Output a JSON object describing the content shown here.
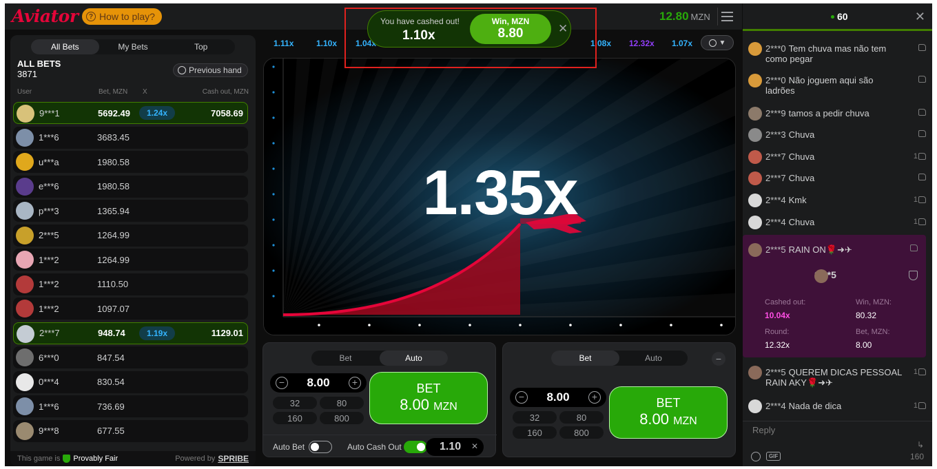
{
  "header": {
    "logo": "Aviator",
    "how_to_play": "How to play?",
    "balance": "12.80",
    "currency": "MZN"
  },
  "bets_panel": {
    "tabs": [
      "All Bets",
      "My Bets",
      "Top"
    ],
    "title": "ALL BETS",
    "count": "3871",
    "previous_hand": "Previous hand",
    "columns": {
      "user": "User",
      "bet": "Bet, MZN",
      "x": "X",
      "cashout": "Cash out, MZN"
    },
    "rows": [
      {
        "user": "9***1",
        "bet": "5692.49",
        "mult": "1.24x",
        "cashout": "7058.69",
        "win": true,
        "avatar_color": "#d8c27a"
      },
      {
        "user": "1***6",
        "bet": "3683.45",
        "mult": "",
        "cashout": "",
        "win": false,
        "avatar_color": "#7d8fa8"
      },
      {
        "user": "u***a",
        "bet": "1980.58",
        "mult": "",
        "cashout": "",
        "win": false,
        "avatar_color": "#e0a81c"
      },
      {
        "user": "e***6",
        "bet": "1980.58",
        "mult": "",
        "cashout": "",
        "win": false,
        "avatar_color": "#5a3c8c"
      },
      {
        "user": "p***3",
        "bet": "1365.94",
        "mult": "",
        "cashout": "",
        "win": false,
        "avatar_color": "#a9b6c4"
      },
      {
        "user": "2***5",
        "bet": "1264.99",
        "mult": "",
        "cashout": "",
        "win": false,
        "avatar_color": "#c8a02a"
      },
      {
        "user": "1***2",
        "bet": "1264.99",
        "mult": "",
        "cashout": "",
        "win": false,
        "avatar_color": "#e8a6b4"
      },
      {
        "user": "1***2",
        "bet": "1110.50",
        "mult": "",
        "cashout": "",
        "win": false,
        "avatar_color": "#b33a3a"
      },
      {
        "user": "1***2",
        "bet": "1097.07",
        "mult": "",
        "cashout": "",
        "win": false,
        "avatar_color": "#b33a3a"
      },
      {
        "user": "2***7",
        "bet": "948.74",
        "mult": "1.19x",
        "cashout": "1129.01",
        "win": true,
        "avatar_color": "#c4ccd4"
      },
      {
        "user": "6***0",
        "bet": "847.54",
        "mult": "",
        "cashout": "",
        "win": false,
        "avatar_color": "#6e6e6e"
      },
      {
        "user": "0***4",
        "bet": "830.54",
        "mult": "",
        "cashout": "",
        "win": false,
        "avatar_color": "#e8e8e8"
      },
      {
        "user": "1***6",
        "bet": "736.69",
        "mult": "",
        "cashout": "",
        "win": false,
        "avatar_color": "#7d8fa8"
      },
      {
        "user": "9***8",
        "bet": "677.55",
        "mult": "",
        "cashout": "",
        "win": false,
        "avatar_color": "#9a8a70"
      }
    ],
    "footer": {
      "prefix": "This game is",
      "provably_fair": "Provably Fair",
      "powered_by": "Powered by",
      "brand": "SPRIBE"
    }
  },
  "history": [
    {
      "v": "1.11x",
      "purple": false
    },
    {
      "v": "1.10x",
      "purple": false
    },
    {
      "v": "1.04x",
      "purple": false
    },
    {
      "v": "1.08x",
      "purple": false
    },
    {
      "v": "12.32x",
      "purple": true
    },
    {
      "v": "1.07x",
      "purple": false
    }
  ],
  "game": {
    "multiplier": "1.35x"
  },
  "notification": {
    "message": "You have cashed out!",
    "multiplier": "1.10x",
    "win_label": "Win, MZN",
    "win_value": "8.80"
  },
  "bet_panels": [
    {
      "tabs": [
        "Bet",
        "Auto"
      ],
      "active_tab": 1,
      "stake": "8.00",
      "chips": [
        "32",
        "80",
        "160",
        "800"
      ],
      "button_label": "BET",
      "button_amount": "8.00",
      "button_currency": "MZN",
      "auto_bet_label": "Auto Bet",
      "auto_cashout_label": "Auto Cash Out",
      "auto_cashout_value": "1.10"
    },
    {
      "tabs": [
        "Bet",
        "Auto"
      ],
      "active_tab": 0,
      "stake": "8.00",
      "chips": [
        "32",
        "80",
        "160",
        "800"
      ],
      "button_label": "BET",
      "button_amount": "8.00",
      "button_currency": "MZN"
    }
  ],
  "chat": {
    "online": "60",
    "messages": [
      {
        "user": "2***0",
        "text": "Tem chuva mas não tem como pegar",
        "likes": "",
        "avatar_color": "#d89a3a"
      },
      {
        "user": "2***0",
        "text": "Não joguem aqui são ladrões",
        "likes": "",
        "avatar_color": "#d89a3a"
      },
      {
        "user": "2***9",
        "text": "tamos a pedir chuva",
        "likes": "",
        "avatar_color": "#8c7a6a"
      },
      {
        "user": "2***3",
        "text": "Chuva",
        "likes": "",
        "avatar_color": "#8a8a8a"
      },
      {
        "user": "2***7",
        "text": "Chuva",
        "likes": "1",
        "avatar_color": "#c05a4a"
      },
      {
        "user": "2***7",
        "text": "Chuva",
        "likes": "",
        "avatar_color": "#c05a4a"
      },
      {
        "user": "2***4",
        "text": "Kmk",
        "likes": "1",
        "avatar_color": "#d8d8d8"
      },
      {
        "user": "2***4",
        "text": "Chuva",
        "likes": "1",
        "avatar_color": "#d8d8d8"
      }
    ],
    "rain": {
      "user": "2***5",
      "text": "RAIN ON🌹➜✈",
      "card_user": "2***5",
      "cashed_out_label": "Cashed out:",
      "cashed_out": "10.04x",
      "win_label": "Win, MZN:",
      "win": "80.32",
      "round_label": "Round:",
      "round": "12.32x",
      "bet_label": "Bet, MZN:",
      "bet": "8.00"
    },
    "after": [
      {
        "user": "2***5",
        "text": "QUEREM DICAS PESSOAL RAIN AKY🌹➜✈",
        "likes": "1",
        "avatar_color": "#8a6a5a"
      },
      {
        "user": "2***4",
        "text": "Nada de dica",
        "likes": "1",
        "avatar_color": "#d8d8d8"
      }
    ],
    "reply_placeholder": "Reply",
    "gif": "GIF",
    "char_count": "160"
  }
}
